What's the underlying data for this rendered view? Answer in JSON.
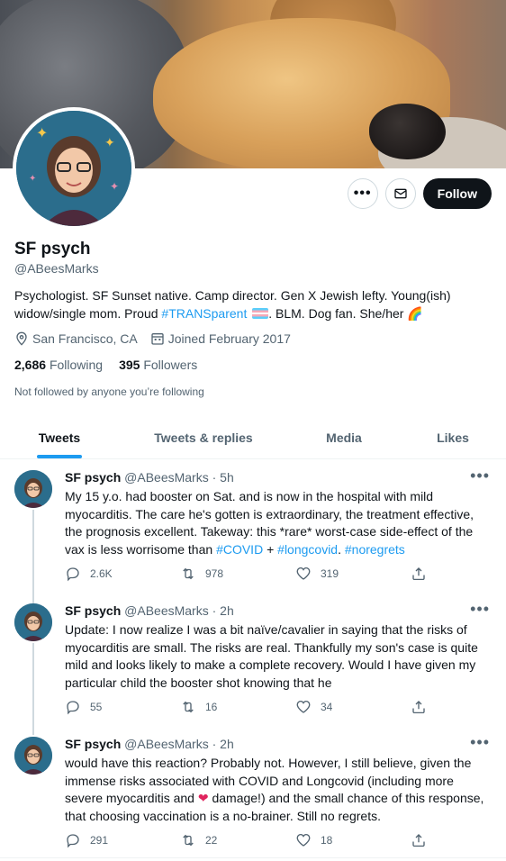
{
  "profile": {
    "name": "SF psych",
    "handle": "@ABeesMarks",
    "bio_part1": "Psychologist. SF Sunset native. Camp director. Gen X Jewish lefty. Young(ish) widow/single mom. Proud ",
    "bio_hashtag": "#TRANSparent",
    "bio_part2": ". BLM. Dog fan. She/her",
    "location": "San Francisco, CA",
    "joined": "Joined February 2017",
    "following_count": "2,686",
    "following_label": "Following",
    "followers_count": "395",
    "followers_label": "Followers",
    "not_followed": "Not followed by anyone you’re following",
    "follow_label": "Follow"
  },
  "tabs": [
    {
      "label": "Tweets"
    },
    {
      "label": "Tweets & replies"
    },
    {
      "label": "Media"
    },
    {
      "label": "Likes"
    }
  ],
  "tweets": [
    {
      "name": "SF psych",
      "meta": "@ABeesMarks · 5h",
      "text": "My 15 y.o. had booster on Sat. and is now in the hospital with mild myocarditis. The care he's gotten is extraordinary, the treatment effective, the prognosis excellent. Takeway: this *rare* worst-case side-effect of the vax is less worrisome than ",
      "tag1": "#COVID",
      "mid": " + ",
      "tag2": "#longcovid",
      "mid2": ". ",
      "tag3": "#noregrets",
      "replies": "2.6K",
      "retweets": "978",
      "likes": "319"
    },
    {
      "name": "SF psych",
      "meta": "@ABeesMarks · 2h",
      "text": "Update: I now realize I was a bit naïve/cavalier in saying that the risks of myocarditis are small. The risks are real. Thankfully my son's case is quite mild and looks likely to make a complete recovery. Would I have given my particular child the booster shot knowing that he",
      "replies": "55",
      "retweets": "16",
      "likes": "34"
    },
    {
      "name": "SF psych",
      "meta": "@ABeesMarks · 2h",
      "text_a": "would have this reaction? Probably not. However, I still believe, given the immense risks associated with COVID and Longcovid (including more severe myocarditis and ",
      "text_b": " damage!) and the small chance of this response, that choosing vaccination is a no-brainer. Still no regrets.",
      "replies": "291",
      "retweets": "22",
      "likes": "18"
    }
  ],
  "colors": {
    "accent": "#1d9bf0",
    "text": "#0f1419",
    "secondary": "#536471",
    "follow_bg": "#0f1419"
  }
}
